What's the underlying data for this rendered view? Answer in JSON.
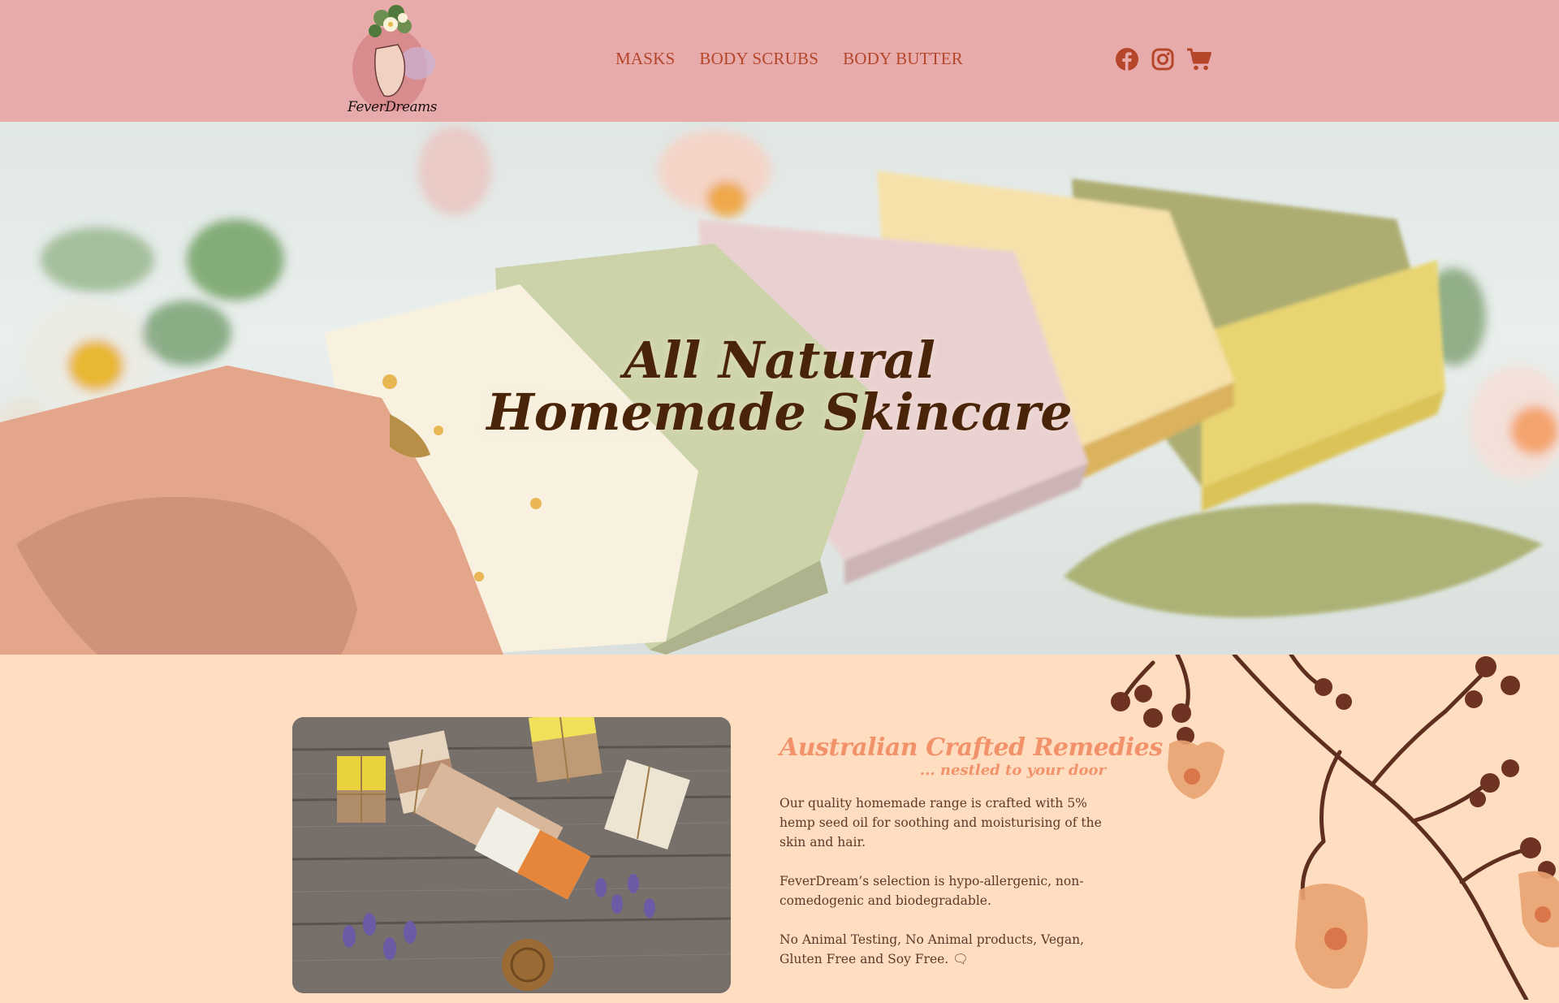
{
  "brand": {
    "name": "FeverDreams"
  },
  "nav": {
    "items": [
      "MASKS",
      "BODY SCRUBS",
      "BODY BUTTER"
    ]
  },
  "social": {
    "icons": [
      "facebook-icon",
      "instagram-icon",
      "cart-icon"
    ]
  },
  "hero": {
    "line1": "All Natural",
    "line2": "Homemade Skincare"
  },
  "about": {
    "heading": "Australian Crafted Remedies",
    "subheading": "... nestled to your door",
    "paragraphs": [
      "Our quality homemade range is crafted with 5% hemp seed oil for soothing and moisturising of the skin and hair.",
      "FeverDream’s selection is hypo-allergenic, non-comedogenic and biodegradable.",
      "No Animal Testing, No Animal products, Vegan, Gluten Free and Soy Free. 🗨"
    ]
  },
  "colors": {
    "header_bg": "#E8ABAC",
    "nav_text": "#B5462A",
    "page_bg": "#FFDDC0",
    "heading_accent": "#F2926A",
    "hero_text": "#4A2408"
  }
}
